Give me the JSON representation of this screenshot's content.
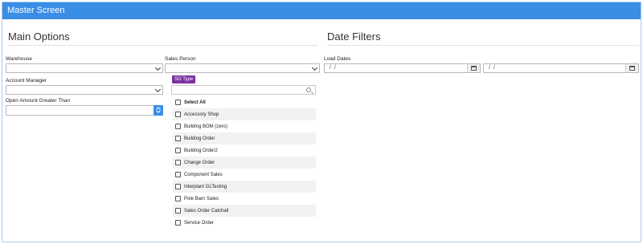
{
  "window": {
    "title": "Master Screen"
  },
  "main_options": {
    "heading": "Main Options",
    "warehouse": {
      "label": "Warehouse",
      "value": ""
    },
    "account_manager": {
      "label": "Account Manager",
      "value": ""
    },
    "open_amount": {
      "label": "Open Amount Greater Than",
      "value": ""
    },
    "sales_person": {
      "label": "Sales Person",
      "value": ""
    },
    "so_type": {
      "badge": "SO Type",
      "search_value": "",
      "items": [
        {
          "label": "Select All",
          "checked": false
        },
        {
          "label": "Accessory Shop",
          "checked": false
        },
        {
          "label": "Building BOM (zero)",
          "checked": false
        },
        {
          "label": "Building Order",
          "checked": false
        },
        {
          "label": "Building Order2",
          "checked": false
        },
        {
          "label": "Change Order",
          "checked": false
        },
        {
          "label": "Component Sales",
          "checked": false
        },
        {
          "label": "Interplant GLTesting",
          "checked": false
        },
        {
          "label": "Pole Barn Sales",
          "checked": false
        },
        {
          "label": "Sales Order Catchall",
          "checked": false
        },
        {
          "label": "Service Order",
          "checked": false
        }
      ]
    }
  },
  "date_filters": {
    "heading": "Date Filters",
    "load_dates": {
      "label": "Load Dates",
      "from": " /  /",
      "to": " /  /"
    }
  },
  "icons": {
    "dropdown": "chevron-down-icon",
    "spinner": "spinner-icon",
    "search": "search-icon",
    "calendar": "calendar-icon"
  },
  "colors": {
    "titlebar": "#3a8ee6",
    "badge": "#7b2fa0",
    "spinner": "#3a8ee6"
  }
}
